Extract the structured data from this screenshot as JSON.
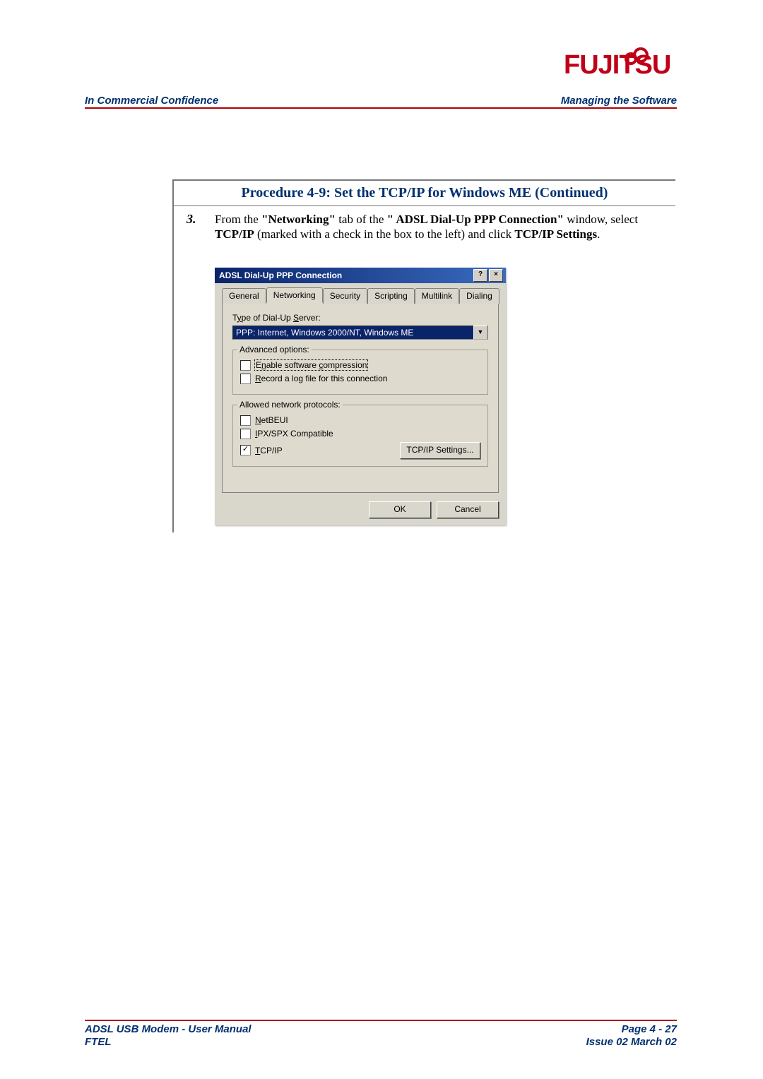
{
  "brand": "FUJITSU",
  "header": {
    "left": "In Commercial Confidence",
    "right": "Managing the Software"
  },
  "footer": {
    "left_line1": "ADSL USB Modem - User Manual",
    "left_line2": "FTEL",
    "right_line1": "Page 4 - 27",
    "right_line2": "Issue 02 March 02"
  },
  "procedure": {
    "title": "Procedure 4-9: Set the TCP/IP for Windows ME (Continued)",
    "step_num": "3.",
    "step_text_pre": "From the ",
    "step_b1": "\"Networking\"",
    "step_mid1": " tab of the ",
    "step_b2": "\" ADSL Dial-Up PPP Connection\"",
    "step_mid2": " window, select ",
    "step_b3": "TCP/IP",
    "step_mid3": " (marked with a check in the box to the left) and click ",
    "step_b4": "TCP/IP Settings",
    "step_end": "."
  },
  "dialog": {
    "title": "ADSL Dial-Up PPP Connection",
    "help_btn": "?",
    "close_btn": "×",
    "tabs": [
      "General",
      "Networking",
      "Security",
      "Scripting",
      "Multilink",
      "Dialing"
    ],
    "server_label": "Type of Dial-Up Server:",
    "server_value": "PPP: Internet, Windows 2000/NT, Windows ME",
    "group_adv": "Advanced options:",
    "adv_opt1": "Enable software compression",
    "adv_opt2": "Record a log file for this connection",
    "group_proto": "Allowed network protocols:",
    "proto1": "NetBEUI",
    "proto2": "IPX/SPX Compatible",
    "proto3": "TCP/IP",
    "tcpip_btn": "TCP/IP Settings...",
    "ok": "OK",
    "cancel": "Cancel"
  }
}
